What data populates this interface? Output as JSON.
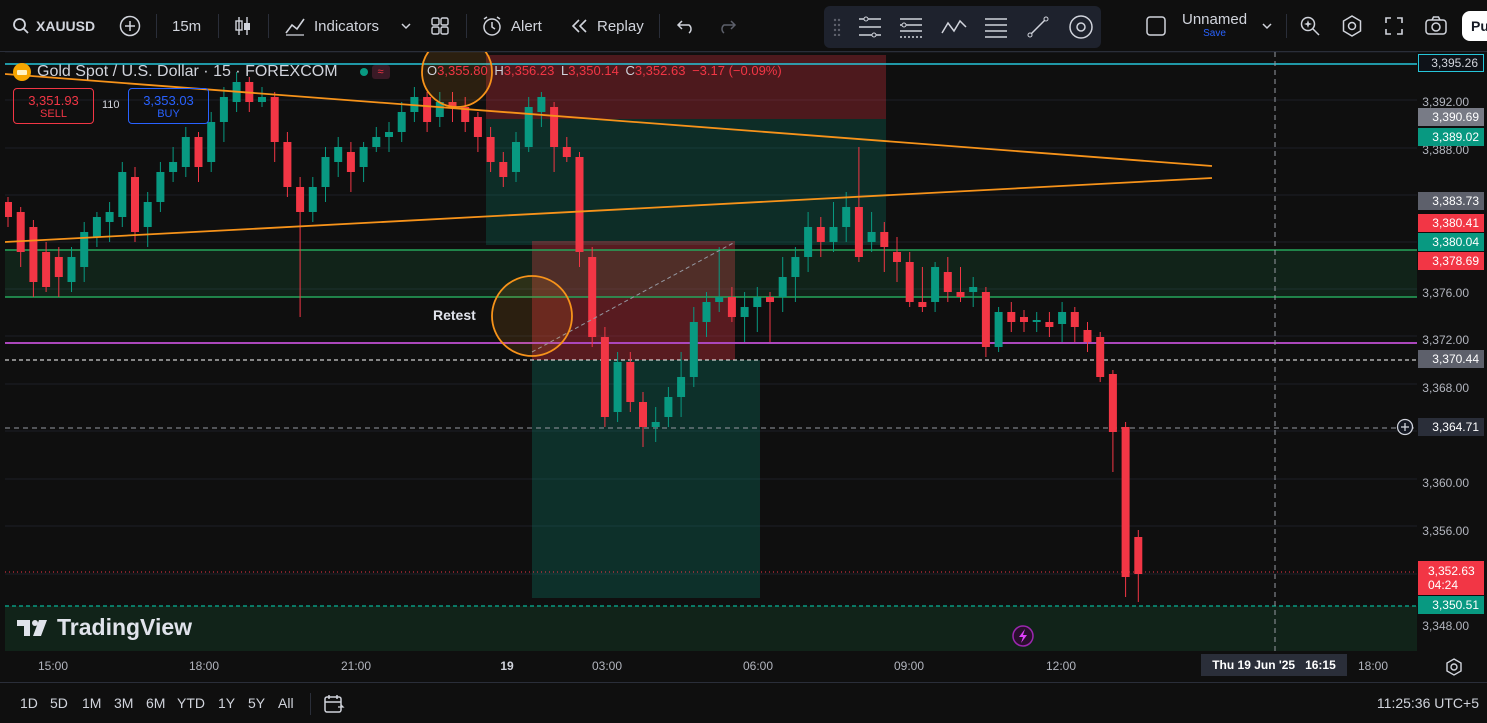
{
  "topbar": {
    "symbol": "XAUUSD",
    "interval": "15m",
    "indicators_label": "Indicators",
    "alert_label": "Alert",
    "replay_label": "Replay",
    "layout_name": "Unnamed",
    "layout_save": "Save",
    "publish_label": "Pu"
  },
  "legend": {
    "title": "Gold Spot / U.S. Dollar · 15 · FOREXCOM",
    "o_label": "O",
    "o_value": "3,355.80",
    "h_label": "H",
    "h_value": "3,356.23",
    "l_label": "L",
    "l_value": "3,350.14",
    "c_label": "C",
    "c_value": "3,352.63",
    "change": "−3.17 (−0.09%)"
  },
  "trade": {
    "sell_price": "3,351.93",
    "sell_label": "SELL",
    "spread": "110",
    "buy_price": "3,353.03",
    "buy_label": "BUY"
  },
  "annotation": {
    "retest": "Retest"
  },
  "watermark": "TradingView",
  "price_ticks": [
    "3,392.00",
    "3,388.00",
    "3,376.00",
    "3,372.00",
    "3,368.00",
    "3,360.00",
    "3,356.00",
    "3,348.00"
  ],
  "price_labels": [
    {
      "text": "3,395.26",
      "bg": "#0e1218",
      "fg": "#d1d4dc",
      "border": "#26c6da"
    },
    {
      "text": "3,390.69",
      "bg": "#787b86",
      "fg": "#ffffff"
    },
    {
      "text": "3,389.02",
      "bg": "#089981",
      "fg": "#ffffff"
    },
    {
      "text": "3,383.73",
      "bg": "#5d606b",
      "fg": "#ffffff"
    },
    {
      "text": "3,380.41",
      "bg": "#f23645",
      "fg": "#ffffff"
    },
    {
      "text": "3,380.04",
      "bg": "#089981",
      "fg": "#ffffff"
    },
    {
      "text": "3,378.69",
      "bg": "#f23645",
      "fg": "#ffffff"
    },
    {
      "text": "3,370.44",
      "bg": "#5d606b",
      "fg": "#ffffff"
    },
    {
      "text": "3,364.71",
      "bg": "#2a2e39",
      "fg": "#ffffff"
    },
    {
      "text": "3,350.51",
      "bg": "#089981",
      "fg": "#ffffff"
    }
  ],
  "last_price": {
    "text": "3,352.63",
    "countdown": "04:24",
    "bg": "#f23645"
  },
  "time_ticks": [
    "15:00",
    "18:00",
    "21:00",
    "19",
    "03:00",
    "06:00",
    "09:00",
    "12:00",
    "18:00"
  ],
  "crosshair_time": "Thu 19 Jun '25   16:15",
  "bottom": {
    "ranges": [
      "1D",
      "5D",
      "1M",
      "3M",
      "6M",
      "YTD",
      "1Y",
      "5Y",
      "All"
    ],
    "clock": "11:25:36 UTC+5"
  },
  "colors": {
    "up": "#089981",
    "down": "#f23645",
    "accent": "#2962ff",
    "trendline": "#f7931a",
    "zone_line": "#26a65b",
    "magenta_line": "#ab47bc"
  }
}
